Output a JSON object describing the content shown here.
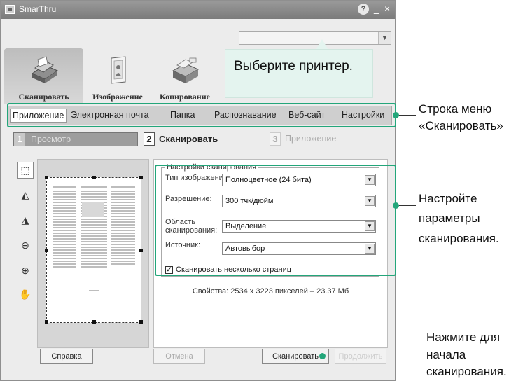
{
  "window": {
    "title": "SmarThru",
    "help_glyph": "?",
    "minimize_glyph": "_",
    "close_glyph": "×"
  },
  "printer_select": {
    "value": "",
    "arrow": "▼"
  },
  "mode_tabs": [
    {
      "label": "Сканировать",
      "icon": "scanner-icon",
      "selected": true
    },
    {
      "label": "Изображение",
      "icon": "image-icon",
      "selected": false
    },
    {
      "label": "Копирование",
      "icon": "copier-icon",
      "selected": false
    }
  ],
  "balloon": {
    "text": "Выберите принтер."
  },
  "menubar": {
    "items": [
      {
        "label": "Приложение",
        "selected": true
      },
      {
        "label": "Электронная почта",
        "selected": false
      },
      {
        "label": "Папка",
        "selected": false
      },
      {
        "label": "Распознавание",
        "selected": false
      },
      {
        "label": "Веб-сайт",
        "selected": false
      },
      {
        "label": "Настройки",
        "selected": false
      }
    ]
  },
  "steps": [
    {
      "number": "1",
      "label": "Просмотр",
      "state": "done"
    },
    {
      "number": "2",
      "label": "Сканировать",
      "state": "active"
    },
    {
      "number": "3",
      "label": "Приложение",
      "state": "disabled"
    }
  ],
  "tools": [
    {
      "icon": "select-area-icon",
      "glyph": "⬚"
    },
    {
      "icon": "rotate-left-icon",
      "glyph": "◭"
    },
    {
      "icon": "rotate-right-icon",
      "glyph": "◮"
    },
    {
      "icon": "zoom-out-icon",
      "glyph": "⊖"
    },
    {
      "icon": "zoom-in-icon",
      "glyph": "⊕"
    },
    {
      "icon": "pan-hand-icon",
      "glyph": "✋"
    }
  ],
  "settings": {
    "group_title": "Настройки сканирования",
    "image_type_label": "Тип изображения:",
    "image_type_value": "Полноцветное (24 бита)",
    "resolution_label": "Разрешение:",
    "resolution_value": "300 тчк/дюйм",
    "area_label_line1": "Область",
    "area_label_line2": "сканирования:",
    "area_value": "Выделение",
    "source_label": "Источник:",
    "source_value": "Автовыбор",
    "select_arrow": "▼",
    "multipage_label": "Сканировать несколько страниц",
    "multipage_checked": true,
    "multipage_check_glyph": "✓",
    "properties_text": "Свойства: 2534 x 3223 пикселей – 23.37 Мб"
  },
  "buttons": {
    "help": "Справка",
    "cancel": "Отмена",
    "scan": "Сканировать",
    "next": "Продолжить"
  },
  "callouts": {
    "menu_line1": "Строка меню",
    "menu_line2": "«Сканировать»",
    "settings_line1": "Настройте",
    "settings_line2": "параметры",
    "settings_line3": "сканирования.",
    "scan_line1": "Нажмите для",
    "scan_line2": "начала",
    "scan_line3": "сканирования."
  },
  "colors": {
    "accent": "#23a67a",
    "balloon": "#e4f4ef",
    "titlebar": "#8a8a8a"
  }
}
